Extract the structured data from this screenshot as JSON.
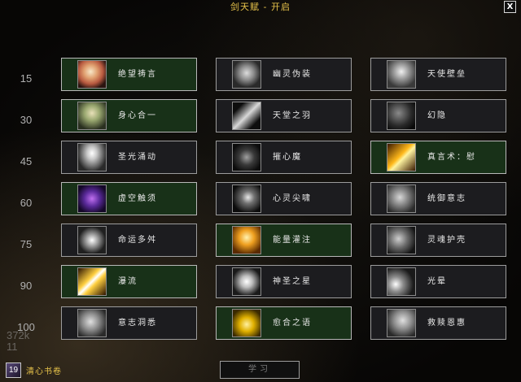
{
  "window": {
    "title": "剑天赋 - 开启",
    "close_label": "X"
  },
  "levels": [
    "15",
    "30",
    "45",
    "60",
    "75",
    "90",
    "100"
  ],
  "rows": [
    [
      {
        "name": "绝望祷言",
        "icon": "prayer-portrait-icon",
        "selected": true
      },
      {
        "name": "幽灵伪装",
        "icon": "spectral-guise-icon",
        "selected": false
      },
      {
        "name": "天使壁垒",
        "icon": "angelic-bulwark-icon",
        "selected": false
      }
    ],
    [
      {
        "name": "身心合一",
        "icon": "body-and-soul-icon",
        "selected": true
      },
      {
        "name": "天堂之羽",
        "icon": "angelic-feather-icon",
        "selected": false
      },
      {
        "name": "幻隐",
        "icon": "phantasm-icon",
        "selected": false
      }
    ],
    [
      {
        "name": "圣光涌动",
        "icon": "surge-of-light-icon",
        "selected": false
      },
      {
        "name": "摧心魔",
        "icon": "mindbender-icon",
        "selected": false
      },
      {
        "name": "真言术：慰",
        "icon": "power-word-solace-icon",
        "selected": true
      }
    ],
    [
      {
        "name": "虚空触须",
        "icon": "void-tendrils-icon",
        "selected": true
      },
      {
        "name": "心灵尖啸",
        "icon": "psychic-scream-icon",
        "selected": false
      },
      {
        "name": "统御意志",
        "icon": "dominate-mind-icon",
        "selected": false
      }
    ],
    [
      {
        "name": "命运多舛",
        "icon": "twist-of-fate-icon",
        "selected": false
      },
      {
        "name": "能量灌注",
        "icon": "power-infusion-icon",
        "selected": true
      },
      {
        "name": "灵魂护壳",
        "icon": "spirit-shell-icon",
        "selected": false
      }
    ],
    [
      {
        "name": "瀑流",
        "icon": "cascade-icon",
        "selected": true
      },
      {
        "name": "神圣之星",
        "icon": "divine-star-icon",
        "selected": false
      },
      {
        "name": "光晕",
        "icon": "halo-icon",
        "selected": false
      }
    ],
    [
      {
        "name": "意志洞悉",
        "icon": "clarity-of-will-icon",
        "selected": false
      },
      {
        "name": "愈合之语",
        "icon": "words-of-mending-icon",
        "selected": true
      },
      {
        "name": "救赎恩惠",
        "icon": "saving-grace-icon",
        "selected": false
      }
    ]
  ],
  "footer": {
    "reagent_count": "19",
    "reagent_label": "清心书卷",
    "learn_label": "学习",
    "background_text": [
      "372k",
      "11"
    ]
  },
  "colors": {
    "title": "#e6c24a",
    "selected_bg": "#183118",
    "unselected_bg": "#1c1c1f"
  }
}
